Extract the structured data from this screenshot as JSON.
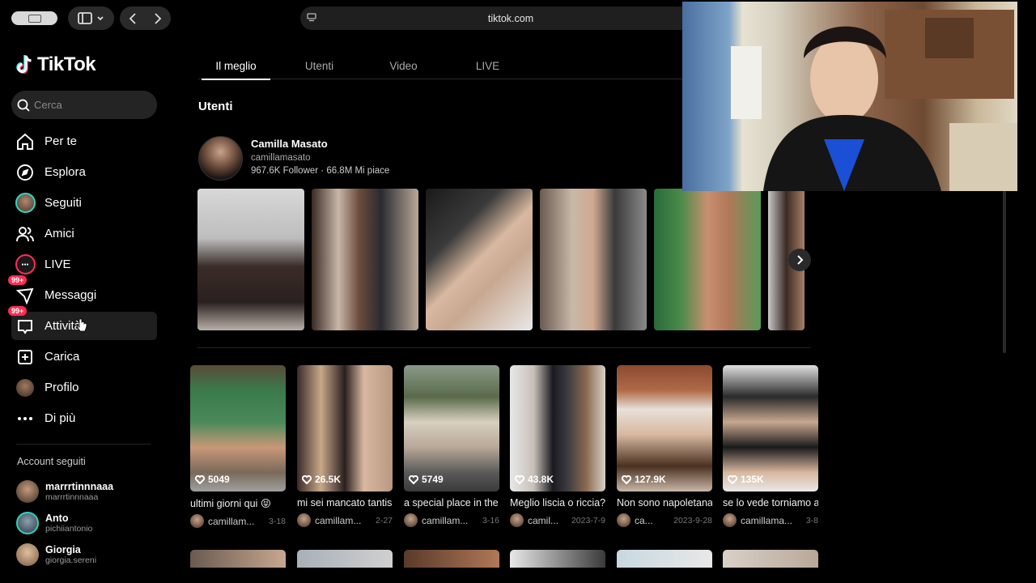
{
  "browser": {
    "url": "tiktok.com"
  },
  "app": {
    "name": "TikTok",
    "search_placeholder": "Cerca"
  },
  "sidebar": {
    "items": [
      {
        "label": "Per te",
        "icon": "home-icon"
      },
      {
        "label": "Esplora",
        "icon": "compass-icon"
      },
      {
        "label": "Seguiti",
        "icon": "following-avatar"
      },
      {
        "label": "Amici",
        "icon": "friends-icon"
      },
      {
        "label": "LIVE",
        "icon": "live-icon"
      },
      {
        "label": "Messaggi",
        "icon": "messages-icon",
        "badge": "99+"
      },
      {
        "label": "Attività",
        "icon": "activity-icon",
        "badge": "99+"
      },
      {
        "label": "Carica",
        "icon": "upload-icon"
      },
      {
        "label": "Profilo",
        "icon": "profile-avatar"
      },
      {
        "label": "Di più",
        "icon": "more-icon"
      }
    ],
    "active_index": 6,
    "following_label": "Account seguiti",
    "following": [
      {
        "name": "marrrtinnnaaa",
        "id": "marrrtinnnaaa"
      },
      {
        "name": "Anto",
        "id": "pichiiantonio"
      },
      {
        "name": "Giorgia",
        "id": "giorgia.sereni"
      }
    ]
  },
  "main": {
    "tabs": [
      "Il meglio",
      "Utenti",
      "Video",
      "LIVE"
    ],
    "active_tab": 0,
    "section_title": "Utenti",
    "user": {
      "name": "Camilla Masato",
      "handle": "camillamasato",
      "stats": "967.6K Follower  ·  66.8M Mi piace"
    },
    "videos": [
      {
        "likes": "5049",
        "desc": "ultimi giorni qui 😝",
        "author": "camillam...",
        "date": "3-18"
      },
      {
        "likes": "26.5K",
        "desc": "mi sei mancato tantissimo",
        "author": "camillam...",
        "date": "2-27"
      },
      {
        "likes": "5749",
        "desc": "a special place in the",
        "author": "camillam...",
        "date": "3-16"
      },
      {
        "likes": "43.8K",
        "desc": "Meglio liscia o riccia?",
        "author": "camil...",
        "date": "2023-7-9"
      },
      {
        "likes": "127.9K",
        "desc": "Non sono napoletana",
        "author": "ca...",
        "date": "2023-9-28"
      },
      {
        "likes": "135K",
        "desc": "se lo vede torniamo a",
        "author": "camillama...",
        "date": "3-8"
      }
    ]
  },
  "colors": {
    "accent": "#fe2c55",
    "teal": "#2dd4bf"
  }
}
